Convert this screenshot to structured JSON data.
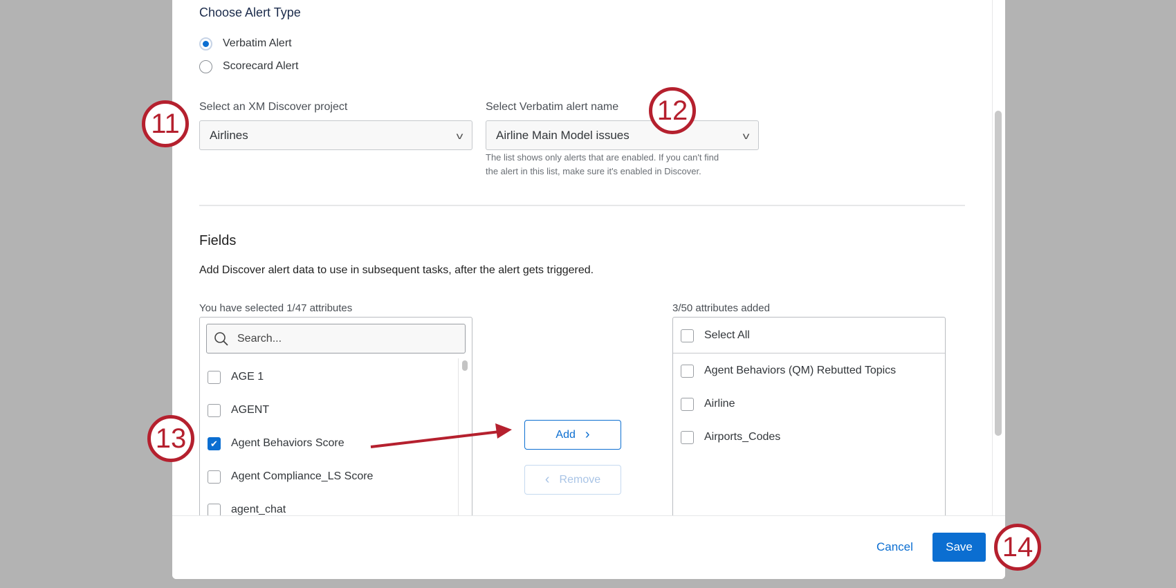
{
  "alert_type": {
    "title": "Choose Alert Type",
    "options": [
      {
        "label": "Verbatim Alert",
        "selected": true
      },
      {
        "label": "Scorecard Alert",
        "selected": false
      }
    ]
  },
  "project": {
    "label": "Select an XM Discover project",
    "value": "Airlines"
  },
  "alert_name": {
    "label": "Select Verbatim alert name",
    "value": "Airline Main Model issues",
    "help_line1": "The list shows only alerts that are enabled. If you can't find",
    "help_line2": "the alert in this list, make sure it's enabled in Discover."
  },
  "fields": {
    "title": "Fields",
    "description": "Add Discover alert data to use in subsequent tasks, after the alert gets triggered.",
    "available_label": "You have selected 1/47 attributes",
    "search_placeholder": "Search...",
    "available": [
      {
        "label": "AGE 1",
        "checked": false
      },
      {
        "label": "AGENT",
        "checked": false
      },
      {
        "label": "Agent Behaviors Score",
        "checked": true
      },
      {
        "label": "Agent Compliance_LS Score",
        "checked": false
      },
      {
        "label": "agent_chat",
        "checked": false
      }
    ],
    "add_label": "Add",
    "remove_label": "Remove",
    "added_label": "3/50 attributes added",
    "select_all": "Select All",
    "added": [
      {
        "label": "Agent Behaviors (QM) Rebutted Topics"
      },
      {
        "label": "Airline"
      },
      {
        "label": "Airports_Codes"
      }
    ]
  },
  "footer": {
    "cancel": "Cancel",
    "save": "Save"
  },
  "annotations": [
    "11",
    "12",
    "13",
    "14"
  ],
  "colors": {
    "accent": "#0b6ed1",
    "annotation": "#b5202e"
  }
}
